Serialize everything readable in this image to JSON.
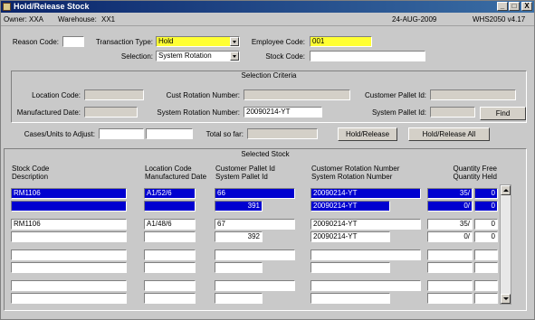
{
  "window": {
    "title": "Hold/Release Stock",
    "minimize_glyph": "_",
    "maximize_glyph": "□",
    "close_glyph": "X"
  },
  "info": {
    "owner_label": "Owner:",
    "owner_value": "XXA",
    "warehouse_label": "Warehouse:",
    "warehouse_value": "XX1",
    "date": "24-AUG-2009",
    "version": "WHS2050  v4.17"
  },
  "header": {
    "reason_code_label": "Reason Code:",
    "reason_code_value": "",
    "transaction_type_label": "Transaction Type:",
    "transaction_type_value": "Hold",
    "employee_code_label": "Employee Code:",
    "employee_code_value": "001",
    "selection_label": "Selection:",
    "selection_value": "System Rotation",
    "stock_code_label": "Stock Code:",
    "stock_code_value": ""
  },
  "criteria": {
    "title": "Selection Criteria",
    "location_code_label": "Location Code:",
    "location_code_value": "",
    "cust_rotation_label": "Cust Rotation Number:",
    "cust_rotation_value": "",
    "customer_pallet_label": "Customer Pallet Id:",
    "customer_pallet_value": "",
    "manufactured_date_label": "Manufactured Date:",
    "manufactured_date_value": "",
    "system_rotation_label": "System Rotation Number:",
    "system_rotation_value": "20090214-YT",
    "system_pallet_label": "System Pallet Id:",
    "system_pallet_value": "",
    "find_label": "Find"
  },
  "adjust": {
    "cases_label": "Cases/Units to Adjust:",
    "cases_value": "",
    "units_value": "",
    "total_label": "Total so far:",
    "total_value": "",
    "hold_release_label": "Hold/Release",
    "hold_release_all_label": "Hold/Release All"
  },
  "selected": {
    "title": "Selected Stock",
    "headers": {
      "stock_code": "Stock Code",
      "description": "Description",
      "location_code": "Location Code",
      "manufactured_date": "Manufactured Date",
      "customer_pallet": "Customer Pallet Id",
      "system_pallet": "System Pallet Id",
      "customer_rotation": "Customer Rotation Number",
      "system_rotation": "System Rotation Number",
      "quantity_free": "Quantity Free",
      "quantity_held": "Quantity Held"
    },
    "rows": [
      {
        "stock_code": "RM1106",
        "description": "",
        "location": "A1/52/6",
        "mfg_date": "",
        "cust_pallet": "66",
        "sys_pallet": "391",
        "cust_rotation": "20090214-YT",
        "sys_rotation": "20090214-YT",
        "qty_free_cases": "35/",
        "qty_free_units": "0",
        "qty_held_cases": "0/",
        "qty_held_units": "0"
      },
      {
        "stock_code": "RM1106",
        "description": "",
        "location": "A1/48/6",
        "mfg_date": "",
        "cust_pallet": "67",
        "sys_pallet": "392",
        "cust_rotation": "20090214-YT",
        "sys_rotation": "20090214-YT",
        "qty_free_cases": "35/",
        "qty_free_units": "0",
        "qty_held_cases": "0/",
        "qty_held_units": "0"
      }
    ]
  },
  "colors": {
    "selected_row": "#0000d0",
    "required_field": "#ffff33",
    "title_bar": "#0a246a"
  }
}
